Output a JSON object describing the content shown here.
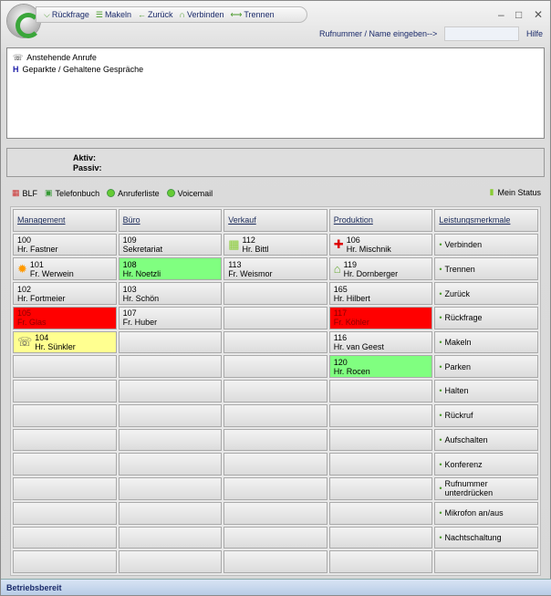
{
  "toolbar": {
    "items": [
      "Rückfrage",
      "Makeln",
      "Zurück",
      "Verbinden",
      "Trennen"
    ],
    "input_label": "Rufnummer / Name eingeben-->",
    "input_value": "",
    "help": "Hilfe"
  },
  "calls": {
    "pending": "Anstehende Anrufe",
    "parked": "Geparkte / Gehaltene Gespräche"
  },
  "active": {
    "aktiv": "Aktiv:",
    "passiv": "Passiv:"
  },
  "tabs": [
    "BLF",
    "Telefonbuch",
    "Anruferliste",
    "Voicemail"
  ],
  "my_status": "Mein Status",
  "columns": [
    "Management",
    "Büro",
    "Verkauf",
    "Produktion",
    "Leistungsmerkmale"
  ],
  "rows": [
    [
      {
        "num": "100",
        "name": "Hr. Fastner"
      },
      {
        "num": "109",
        "name": "Sekretariat"
      },
      {
        "num": "112",
        "name": "Hr. Bittl",
        "icon": "grid"
      },
      {
        "num": "106",
        "name": "Hr. Mischnik",
        "icon": "cross"
      }
    ],
    [
      {
        "num": "101",
        "name": "Fr. Werwein",
        "icon": "sun"
      },
      {
        "num": "108",
        "name": "Hr. Noetzli",
        "state": "green"
      },
      {
        "num": "113",
        "name": "Fr. Weismor"
      },
      {
        "num": "119",
        "name": "Hr. Dornberger",
        "icon": "home"
      }
    ],
    [
      {
        "num": "102",
        "name": "Hr. Fortmeier"
      },
      {
        "num": "103",
        "name": "Hr. Schön"
      },
      {},
      {
        "num": "165",
        "name": "Hr. Hilbert"
      }
    ],
    [
      {
        "num": "105",
        "name": "Fr. Glas",
        "state": "red"
      },
      {
        "num": "107",
        "name": "Fr. Huber"
      },
      {},
      {
        "num": "117",
        "name": "Fr. Köhler",
        "state": "red"
      }
    ],
    [
      {
        "num": "104",
        "name": "Hr. Sünkler",
        "state": "yellow",
        "icon": "phone"
      },
      {},
      {},
      {
        "num": "116",
        "name": "Hr. van Geest"
      }
    ],
    [
      {},
      {},
      {},
      {
        "num": "120",
        "name": "Hr. Rocen",
        "state": "green"
      }
    ]
  ],
  "features": [
    "Verbinden",
    "Trennen",
    "Zurück",
    "Rückfrage",
    "Makeln",
    "Parken",
    "Halten",
    "Rückruf",
    "Aufschalten",
    "Konferenz",
    "Rufnummer unterdrücken",
    "Mikrofon an/aus",
    "Nachtschaltung"
  ],
  "status": "Betriebsbereit"
}
